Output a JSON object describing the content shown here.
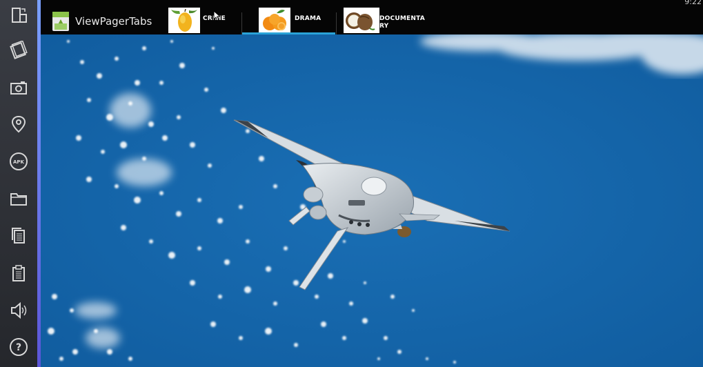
{
  "status_bar": {
    "time": "9:22"
  },
  "toolbar": {
    "items": [
      {
        "name": "rotate-icon"
      },
      {
        "name": "shake-icon"
      },
      {
        "name": "camera-icon"
      },
      {
        "name": "location-icon"
      },
      {
        "name": "apk-icon",
        "text": "APK"
      },
      {
        "name": "folder-icon"
      },
      {
        "name": "copy-icon"
      },
      {
        "name": "paste-icon"
      },
      {
        "name": "volume-icon"
      },
      {
        "name": "help-icon",
        "text": "?"
      }
    ]
  },
  "actionbar": {
    "title": "ViewPagerTabs",
    "tabs": [
      {
        "label": "CRIME",
        "icon": "mango-icon",
        "selected": false
      },
      {
        "label": "DRAMA",
        "icon": "orange-icon",
        "selected": true
      },
      {
        "label": "DOCUMENTA\nRY",
        "icon": "coconut-icon",
        "selected": false
      }
    ]
  },
  "content": {
    "image": "space-shuttle-over-ocean"
  },
  "colors": {
    "accent": "#2aa3d8",
    "ocean": "#1565a8",
    "toolbar": "#2c2e33"
  }
}
